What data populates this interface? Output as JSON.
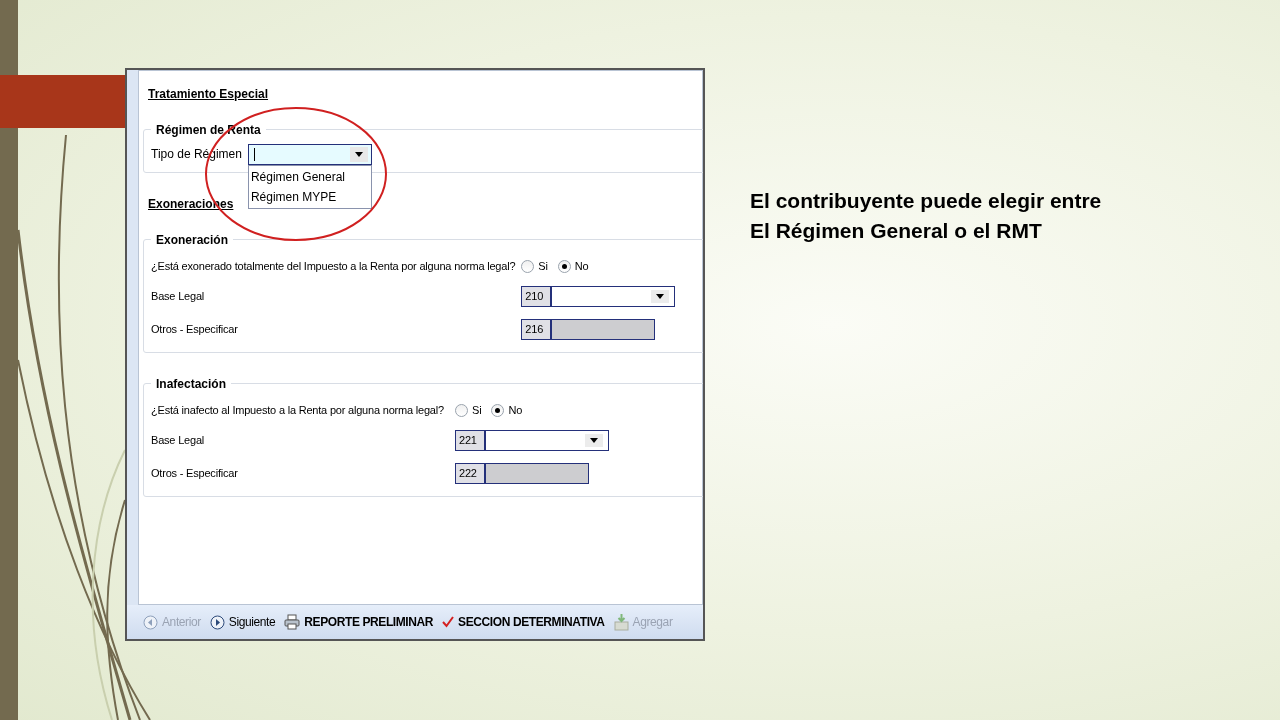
{
  "slide": {
    "caption": "El contribuyente puede elegir entre\nEl Régimen General o el RMT"
  },
  "form": {
    "title": "Tratamiento Especial",
    "regimen": {
      "legend": "Régimen de Renta",
      "label": "Tipo de Régimen",
      "expanded": true,
      "options": [
        "Régimen General",
        "Régimen MYPE"
      ]
    },
    "section_title": "Exoneraciones",
    "groups": [
      {
        "legend": "Exoneración",
        "question": "¿Está exonerado totalmente del Impuesto a la Renta por alguna norma legal?",
        "options": [
          {
            "label": "Si",
            "selected": false
          },
          {
            "label": "No",
            "selected": true
          }
        ],
        "fields": [
          {
            "label": "Base Legal",
            "code": "210",
            "kind": "select"
          },
          {
            "label": "Otros - Especificar",
            "code": "216",
            "kind": "text"
          }
        ]
      },
      {
        "legend": "Inafectación",
        "question": "¿Está inafecto al Impuesto a la Renta por alguna norma legal?",
        "options": [
          {
            "label": "Si",
            "selected": false
          },
          {
            "label": "No",
            "selected": true
          }
        ],
        "fields": [
          {
            "label": "Base Legal",
            "code": "221",
            "kind": "select"
          },
          {
            "label": "Otros - Especificar",
            "code": "222",
            "kind": "text"
          }
        ]
      }
    ]
  },
  "toolbar": [
    {
      "label": "Anterior",
      "kind": "prev",
      "disabled": true,
      "bold": false
    },
    {
      "label": "Siguiente",
      "kind": "next",
      "disabled": false,
      "bold": false
    },
    {
      "label": "REPORTE PRELIMINAR",
      "kind": "print",
      "disabled": false,
      "bold": true
    },
    {
      "label": "SECCION DETERMINATIVA",
      "kind": "check",
      "disabled": false,
      "bold": true
    },
    {
      "label": "Agregar",
      "kind": "add",
      "disabled": true,
      "bold": false
    }
  ]
}
